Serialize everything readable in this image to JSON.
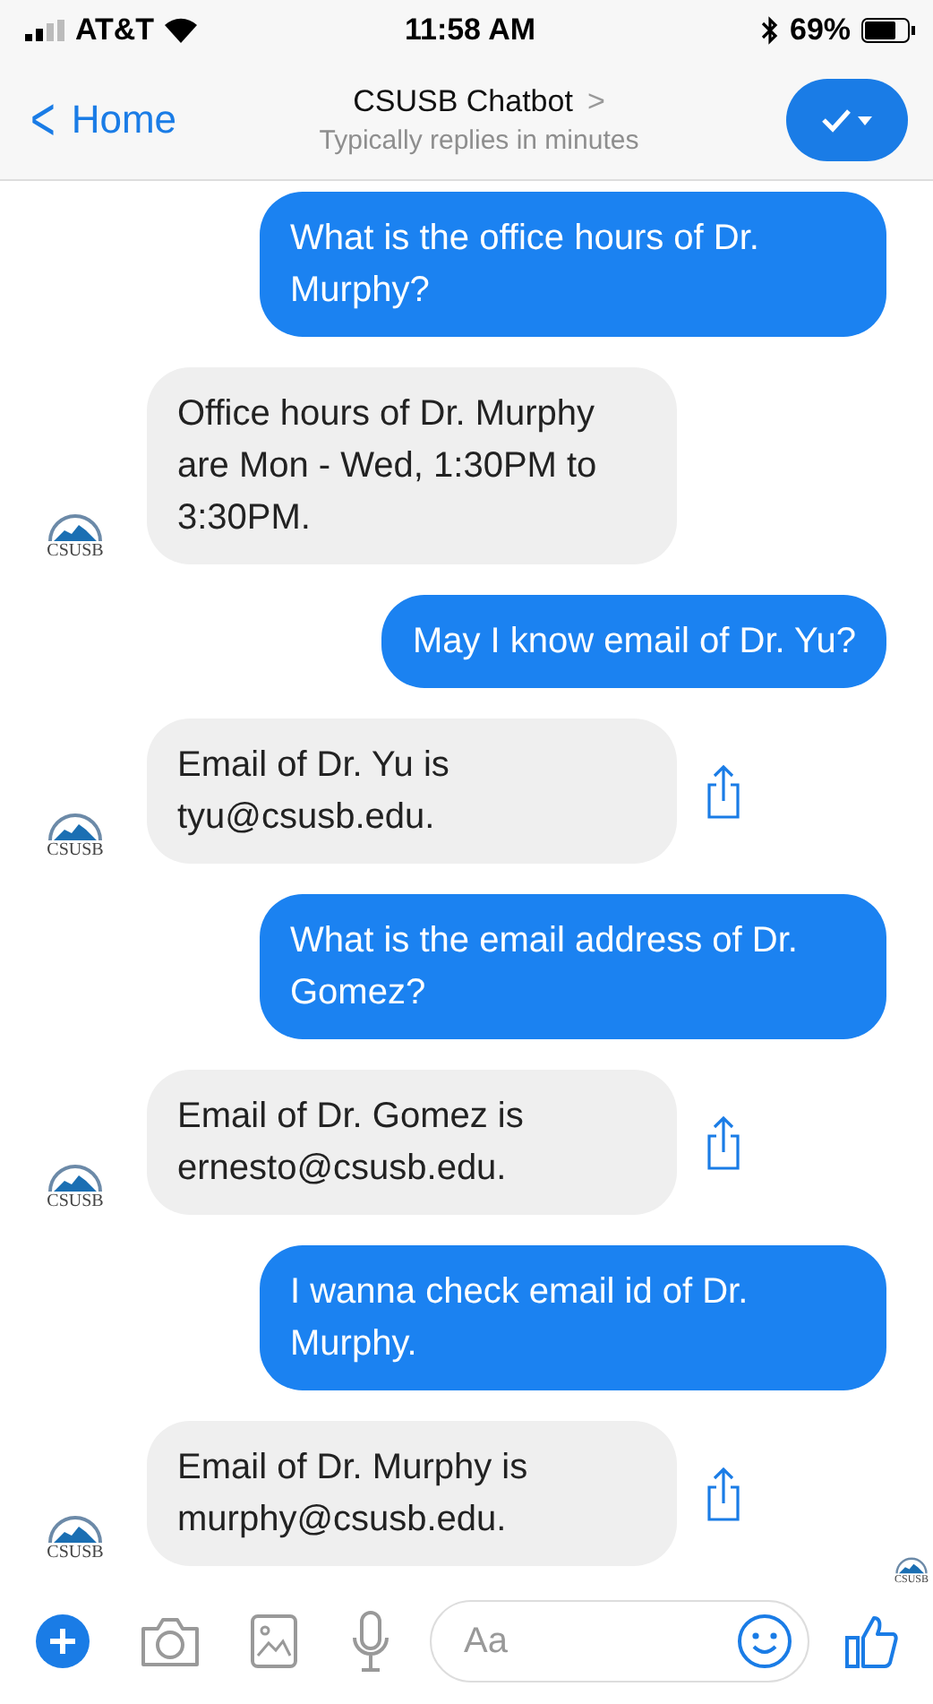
{
  "status_bar": {
    "carrier": "AT&T",
    "time": "11:58 AM",
    "battery": "69%"
  },
  "header": {
    "back": "Home",
    "back_icon": "<",
    "title": "CSUSB Chatbot",
    "title_chevron": ">",
    "subtitle": "Typically replies in minutes"
  },
  "messages": [
    {
      "kind": "user",
      "text": "What is the office hours of Dr. Murphy?"
    },
    {
      "kind": "bot",
      "text": "Office hours of Dr. Murphy are Mon - Wed, 1:30PM to 3:30PM.",
      "avatar": "CSUSB",
      "share": false
    },
    {
      "kind": "user",
      "text": "May I know email of Dr. Yu?"
    },
    {
      "kind": "bot",
      "text": "Email of Dr. Yu is tyu@csusb.edu.",
      "avatar": "CSUSB",
      "share": true
    },
    {
      "kind": "user",
      "text": "What is the email address of Dr. Gomez?"
    },
    {
      "kind": "bot",
      "text": "Email of Dr. Gomez is ernesto@csusb.edu.",
      "avatar": "CSUSB",
      "share": true
    },
    {
      "kind": "user",
      "text": "I wanna check email id of Dr. Murphy."
    },
    {
      "kind": "bot",
      "text": "Email of Dr. Murphy is murphy@csusb.edu.",
      "avatar": "CSUSB",
      "share": true
    }
  ],
  "seen_avatar": "CSUSB",
  "composer": {
    "placeholder": "Aa"
  }
}
